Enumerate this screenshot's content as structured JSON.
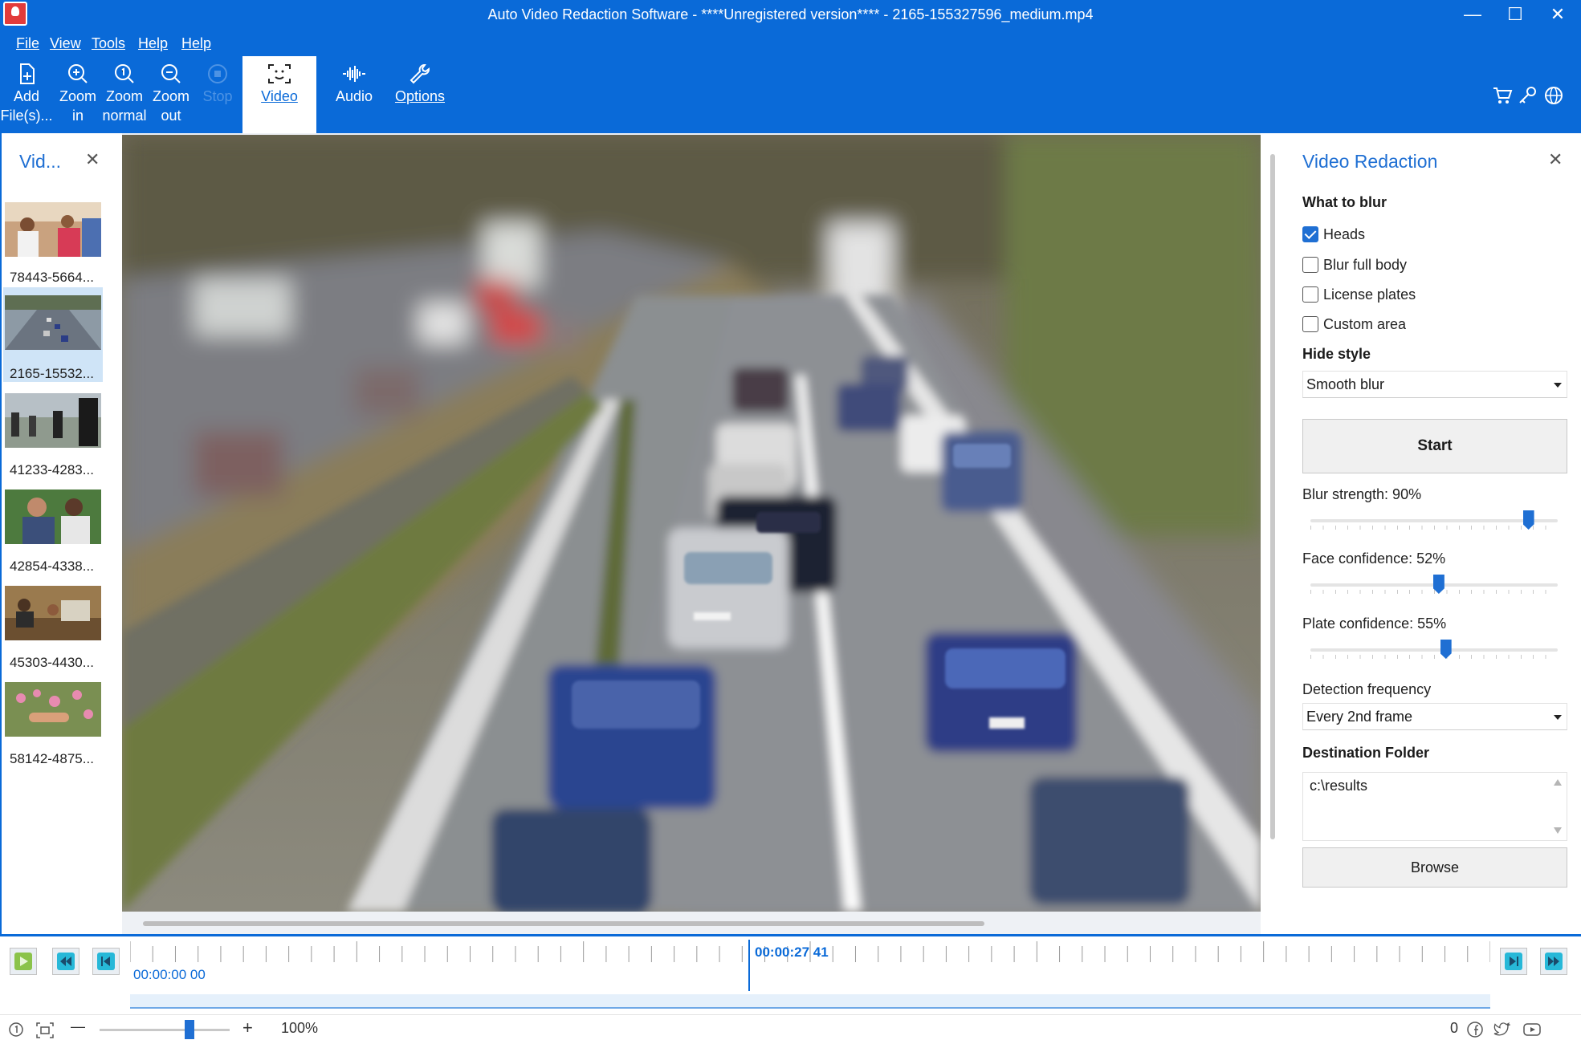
{
  "window": {
    "title": "Auto Video Redaction Software - ****Unregistered version**** - 2165-155327596_medium.mp4",
    "minimize": "—",
    "maximize": "☐",
    "close": "✕"
  },
  "menu": {
    "items": [
      "File",
      "View",
      "Tools",
      "Help",
      "Help"
    ]
  },
  "ribbon": {
    "buttons": [
      {
        "line1": "Add",
        "line2": "File(s)...",
        "icon": "add-file-icon"
      },
      {
        "line1": "Zoom",
        "line2": "in",
        "icon": "zoom-in-icon"
      },
      {
        "line1": "Zoom",
        "line2": "normal",
        "icon": "zoom-normal-icon"
      },
      {
        "line1": "Zoom",
        "line2": "out",
        "icon": "zoom-out-icon"
      },
      {
        "line1": "Stop",
        "line2": "",
        "icon": "stop-icon"
      },
      {
        "line1": "Video",
        "line2": "",
        "icon": "face-scan-icon"
      },
      {
        "line1": "Audio",
        "line2": "",
        "icon": "audio-wave-icon"
      },
      {
        "line1": "Options",
        "line2": "",
        "icon": "wrench-icon"
      }
    ],
    "right_icons": [
      "cart-icon",
      "key-icon",
      "globe-icon"
    ]
  },
  "left_panel": {
    "title": "Vid...",
    "close": "✕",
    "files": [
      {
        "label": "78443-5664..."
      },
      {
        "label": "2165-15532..."
      },
      {
        "label": "41233-4283..."
      },
      {
        "label": "42854-4338..."
      },
      {
        "label": "45303-4430..."
      },
      {
        "label": "58142-4875..."
      }
    ]
  },
  "right_panel": {
    "title": "Video Redaction",
    "close": "✕",
    "what_to_blur_label": "What to blur",
    "options": [
      {
        "label": "Heads",
        "checked": true
      },
      {
        "label": "Blur full body",
        "checked": false
      },
      {
        "label": "License plates",
        "checked": false
      },
      {
        "label": "Custom area",
        "checked": false
      }
    ],
    "hide_style_label": "Hide style",
    "hide_style_value": "Smooth blur",
    "start_label": "Start",
    "blur_strength_label": "Blur strength: 90%",
    "blur_strength": 0.9,
    "face_confidence_label": "Face confidence: 52%",
    "face_confidence": 0.52,
    "plate_confidence_label": "Plate confidence: 55%",
    "plate_confidence": 0.55,
    "detection_frequency_label": "Detection frequency",
    "detection_frequency_value": "Every 2nd frame",
    "destination_folder_label": "Destination Folder",
    "destination_folder_value": "c:\\results",
    "browse_label": "Browse"
  },
  "timeline": {
    "current_time": "00:00:27 41",
    "start_time": "00:00:00 00"
  },
  "statusbar": {
    "zoom_minus": "—",
    "zoom_plus": "+",
    "zoom_value": "100%",
    "counter": "0"
  },
  "colors": {
    "accent": "#0a6ad8",
    "panel_title": "#1f6fd3"
  }
}
